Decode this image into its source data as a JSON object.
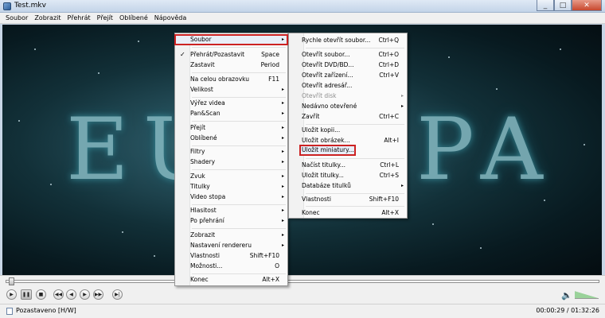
{
  "window": {
    "title": "Test.mkv",
    "min": "_",
    "max": "□",
    "close": "✕"
  },
  "menubar": [
    "Soubor",
    "Zobrazit",
    "Přehrát",
    "Přejít",
    "Oblíbené",
    "Nápověda"
  ],
  "menu1": [
    {
      "label": "Soubor",
      "arrow": "▸",
      "highlight": true
    },
    {
      "label": "Přehrát/Pozastavit",
      "shortcut": "Space",
      "check": "✓"
    },
    {
      "label": "Zastavit",
      "shortcut": "Period"
    },
    {
      "label": "Na celou obrazovku",
      "shortcut": "F11"
    },
    {
      "label": "Velikost",
      "arrow": "▸"
    },
    {
      "label": "Výřez videa",
      "arrow": "▸"
    },
    {
      "label": "Pan&Scan",
      "arrow": "▸"
    },
    {
      "label": "Přejít",
      "arrow": "▸"
    },
    {
      "label": "Oblíbené",
      "arrow": "▸"
    },
    {
      "label": "Filtry",
      "arrow": "▸"
    },
    {
      "label": "Shadery",
      "arrow": "▸"
    },
    {
      "label": "Zvuk",
      "arrow": "▸"
    },
    {
      "label": "Titulky",
      "arrow": "▸"
    },
    {
      "label": "Video stopa",
      "arrow": "▸"
    },
    {
      "label": "Hlasitost",
      "arrow": "▸"
    },
    {
      "label": "Po přehrání",
      "arrow": "▸"
    },
    {
      "label": "Zobrazit",
      "arrow": "▸"
    },
    {
      "label": "Nastavení rendereru",
      "arrow": "▸"
    },
    {
      "label": "Vlastnosti",
      "shortcut": "Shift+F10"
    },
    {
      "label": "Možnosti...",
      "shortcut": "O"
    },
    {
      "label": "Konec",
      "shortcut": "Alt+X"
    }
  ],
  "menu2": [
    {
      "label": "Rychle otevřít soubor...",
      "shortcut": "Ctrl+Q"
    },
    {
      "label": "Otevřít soubor...",
      "shortcut": "Ctrl+O"
    },
    {
      "label": "Otevřít DVD/BD...",
      "shortcut": "Ctrl+D"
    },
    {
      "label": "Otevřít zařízení...",
      "shortcut": "Ctrl+V"
    },
    {
      "label": "Otevřít adresář..."
    },
    {
      "label": "Otevřít disk",
      "arrow": "▸",
      "disabled": true
    },
    {
      "label": "Nedávno otevřené",
      "arrow": "▸"
    },
    {
      "label": "Zavřít",
      "shortcut": "Ctrl+C"
    },
    {
      "label": "Uložit kopii..."
    },
    {
      "label": "Uložit obrázek...",
      "shortcut": "Alt+I"
    },
    {
      "label": "Uložit miniatury...",
      "highlight": true
    },
    {
      "label": "Načíst titulky...",
      "shortcut": "Ctrl+L"
    },
    {
      "label": "Uložit titulky...",
      "shortcut": "Ctrl+S"
    },
    {
      "label": "Databáze titulků",
      "arrow": "▸"
    },
    {
      "label": "Vlastnosti",
      "shortcut": "Shift+F10"
    },
    {
      "label": "Konec",
      "shortcut": "Alt+X"
    }
  ],
  "video": {
    "title_left": "EU",
    "title_right": "PA"
  },
  "controls": {
    "play": "▶",
    "pause": "❚❚",
    "stop": "■",
    "prev": "◀◀",
    "rewind": "◀",
    "forward": "▶",
    "next": "▶▶",
    "frame_step": "▶|",
    "volume_icon": "🔈",
    "volume_level": 0.5,
    "seek_position": 0.006
  },
  "status": {
    "text": "Pozastaveno [H/W]",
    "time": "00:00:29 / 01:32:26"
  },
  "colors": {
    "highlight_border": "#cc2222",
    "accent": "#2b5d99"
  }
}
